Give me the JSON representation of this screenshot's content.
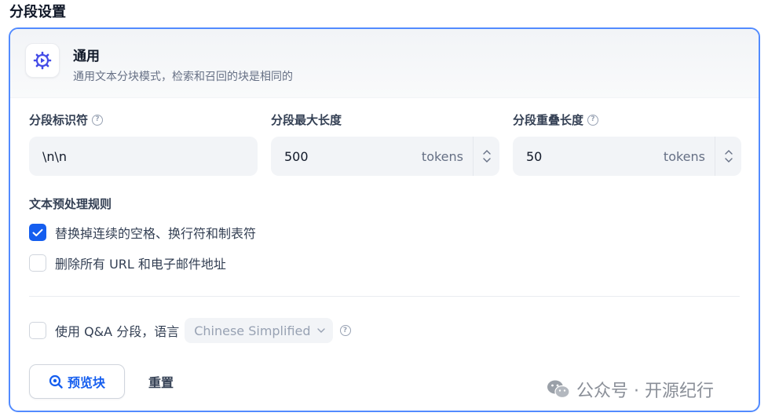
{
  "page_title": "分段设置",
  "mode": {
    "title": "通用",
    "description": "通用文本分块模式，检索和召回的块是相同的",
    "icon": "gear-play-icon",
    "accent": "#444ce7"
  },
  "fields": {
    "separator": {
      "label": "分段标识符",
      "value": "\\n\\n"
    },
    "max_length": {
      "label": "分段最大长度",
      "value": "500",
      "unit": "tokens"
    },
    "overlap": {
      "label": "分段重叠长度",
      "value": "50",
      "unit": "tokens"
    }
  },
  "preprocess": {
    "label": "文本预处理规则",
    "rules": [
      {
        "label": "替换掉连续的空格、换行符和制表符",
        "checked": true
      },
      {
        "label": "删除所有 URL 和电子邮件地址",
        "checked": false
      }
    ]
  },
  "qa": {
    "label": "使用 Q&A 分段，语言",
    "checked": false,
    "language": "Chinese Simplified"
  },
  "actions": {
    "preview": "预览块",
    "reset": "重置"
  },
  "watermark": {
    "text": "公众号 · 开源纪行",
    "icon": "wechat-icon"
  },
  "colors": {
    "primary": "#155eef",
    "card_border": "#528bff"
  }
}
